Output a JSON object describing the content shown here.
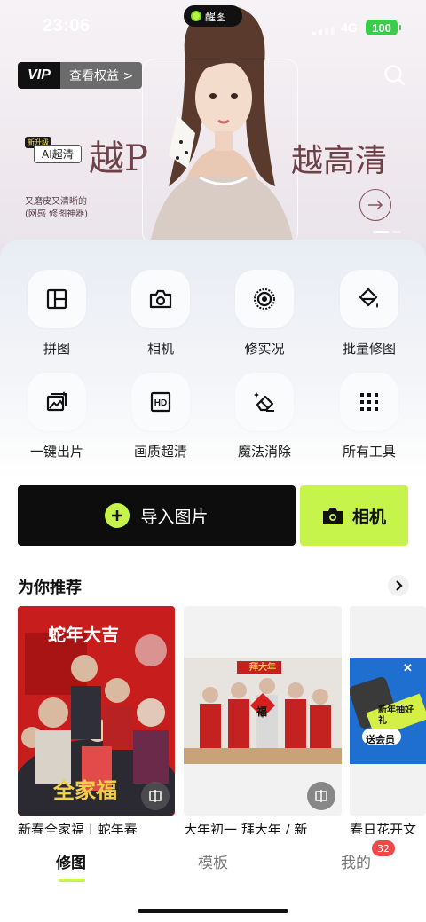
{
  "status_bar": {
    "time": "23:06",
    "island_label": "醒图",
    "network": "4G",
    "battery": "100"
  },
  "banner": {
    "vip_label": "VIP",
    "vip_benefits": "查看权益 >",
    "new_tag": "新升级",
    "ai_tag": "AI超清",
    "headline_left": "越P",
    "headline_right": "越高清",
    "sub_line1": "又磨皮又清晰的",
    "sub_line2": "(网感      修图神器)"
  },
  "tools": [
    {
      "label": "拼图",
      "icon": "collage-icon"
    },
    {
      "label": "相机",
      "icon": "camera-icon"
    },
    {
      "label": "修实况",
      "icon": "live-photo-icon"
    },
    {
      "label": "批量修图",
      "icon": "batch-edit-icon"
    },
    {
      "label": "一键出片",
      "icon": "one-click-icon"
    },
    {
      "label": "画质超清",
      "icon": "hd-icon"
    },
    {
      "label": "魔法消除",
      "icon": "eraser-icon"
    },
    {
      "label": "所有工具",
      "icon": "grid-icon"
    }
  ],
  "actions": {
    "import_label": "导入图片",
    "camera_label": "相机"
  },
  "recommend": {
    "title": "为你推荐",
    "cards": [
      {
        "caption": "新春全家福 | 蛇年春",
        "art_text_top": "蛇年大吉",
        "art_text_bottom": "全家福"
      },
      {
        "caption": "大年初一 拜大年 / 新",
        "art_text_top": "拜大年",
        "art_text_bottom": "福"
      },
      {
        "caption": "春日花开文",
        "art_text_top": "新年抽好礼",
        "art_text_bottom": "送会员"
      }
    ]
  },
  "tabbar": {
    "tabs": [
      "修图",
      "模板",
      "我的"
    ],
    "badge": "32"
  },
  "colors": {
    "accent": "#c6f44a",
    "badge": "#f04848",
    "dark": "#0d0d0d"
  }
}
